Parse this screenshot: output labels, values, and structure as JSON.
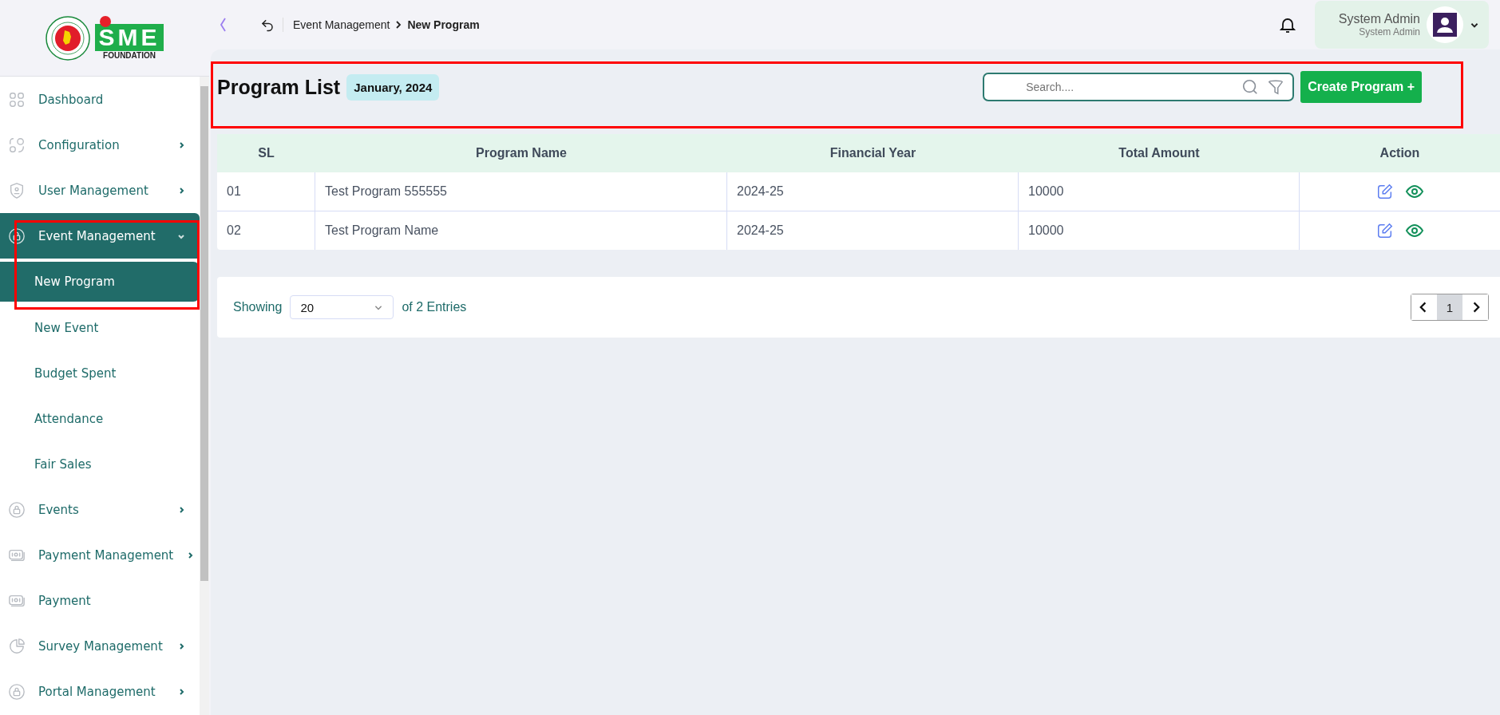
{
  "logo": {
    "title": "SME",
    "subtitle": "FOUNDATION"
  },
  "sidebar": {
    "items": [
      {
        "label": "Dashboard",
        "selected": false
      },
      {
        "label": "Configuration",
        "expanded": false,
        "selected": false
      },
      {
        "label": "User Management",
        "expanded": false,
        "selected": false
      },
      {
        "label": "Event Management",
        "expanded": true,
        "selected": true,
        "children": [
          {
            "label": "New Program",
            "selected": true
          },
          {
            "label": "New Event",
            "selected": false
          },
          {
            "label": "Budget Spent",
            "selected": false
          },
          {
            "label": "Attendance",
            "selected": false
          },
          {
            "label": "Fair Sales",
            "selected": false
          }
        ]
      },
      {
        "label": "Events",
        "expanded": false,
        "selected": false
      },
      {
        "label": "Payment Management",
        "expanded": false,
        "selected": false
      },
      {
        "label": "Payment",
        "selected": false
      },
      {
        "label": "Survey Management",
        "expanded": false,
        "selected": false
      },
      {
        "label": "Portal Management",
        "expanded": false,
        "selected": false
      }
    ]
  },
  "breadcrumb": {
    "parent": "Event Management",
    "current": "New Program"
  },
  "user": {
    "name": "System Admin",
    "role": "System Admin"
  },
  "page": {
    "title": "Program List",
    "period": "January, 2024"
  },
  "search": {
    "placeholder": "Search...."
  },
  "create_button": "Create Program +",
  "table": {
    "columns": [
      "SL",
      "Program Name",
      "Financial Year",
      "Total Amount",
      "Action"
    ],
    "rows": [
      {
        "sl": "01",
        "program_name": "Test Program 555555",
        "financial_year": "2024-25",
        "total_amount": "10000"
      },
      {
        "sl": "02",
        "program_name": "Test Program Name",
        "financial_year": "2024-25",
        "total_amount": "10000"
      }
    ]
  },
  "pagination": {
    "showing_label": "Showing",
    "page_size": "20",
    "entries_label": "of 2 Entries",
    "pages": [
      {
        "label": "1",
        "selected": true
      }
    ]
  }
}
